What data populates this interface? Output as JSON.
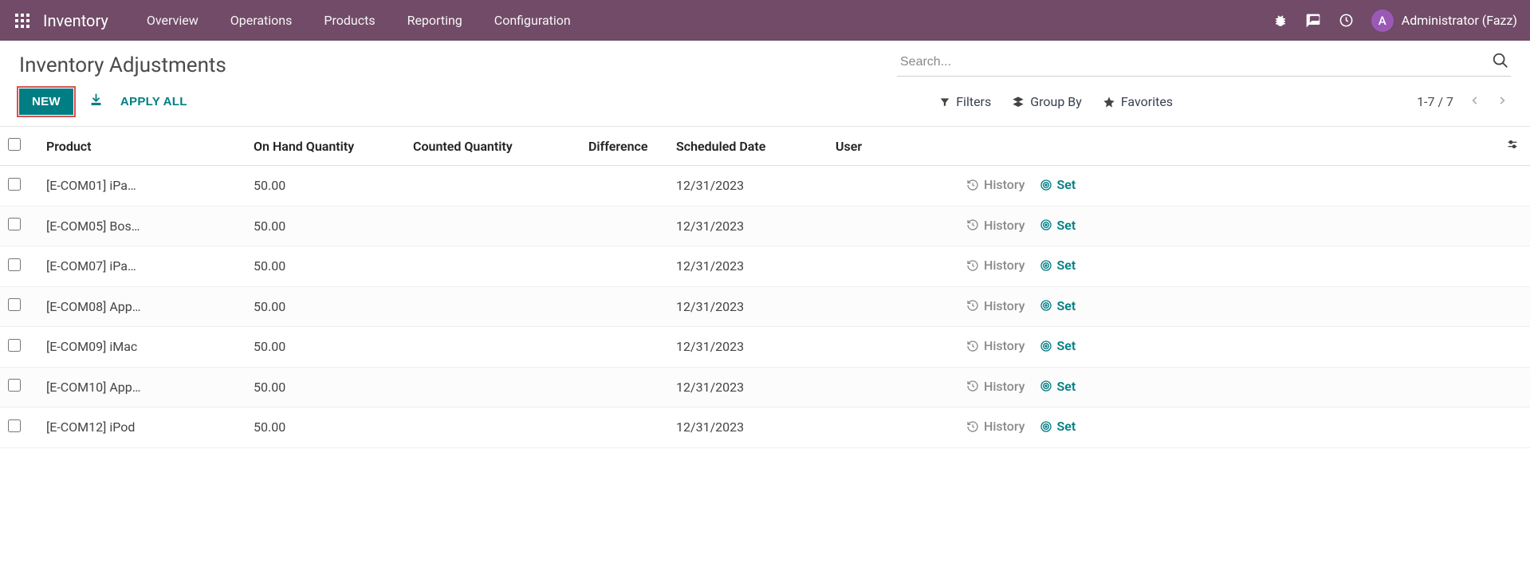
{
  "navbar": {
    "app_name": "Inventory",
    "links": [
      "Overview",
      "Operations",
      "Products",
      "Reporting",
      "Configuration"
    ],
    "user_initial": "A",
    "user_name": "Administrator (Fazz)"
  },
  "page": {
    "title": "Inventory Adjustments",
    "new_label": "NEW",
    "apply_all_label": "APPLY ALL",
    "search_placeholder": "Search...",
    "filters_label": "Filters",
    "groupby_label": "Group By",
    "favorites_label": "Favorites",
    "pager": "1-7 / 7"
  },
  "table": {
    "headers": {
      "product": "Product",
      "onhand": "On Hand Quantity",
      "counted": "Counted Quantity",
      "difference": "Difference",
      "scheduled": "Scheduled Date",
      "user": "User"
    },
    "row_actions": {
      "history": "History",
      "set": "Set"
    },
    "rows": [
      {
        "product": "[E-COM01] iPa…",
        "onhand": "50.00",
        "counted": "",
        "difference": "",
        "date": "12/31/2023",
        "user": ""
      },
      {
        "product": "[E-COM05] Bos…",
        "onhand": "50.00",
        "counted": "",
        "difference": "",
        "date": "12/31/2023",
        "user": ""
      },
      {
        "product": "[E-COM07] iPa…",
        "onhand": "50.00",
        "counted": "",
        "difference": "",
        "date": "12/31/2023",
        "user": ""
      },
      {
        "product": "[E-COM08] App…",
        "onhand": "50.00",
        "counted": "",
        "difference": "",
        "date": "12/31/2023",
        "user": ""
      },
      {
        "product": "[E-COM09] iMac",
        "onhand": "50.00",
        "counted": "",
        "difference": "",
        "date": "12/31/2023",
        "user": ""
      },
      {
        "product": "[E-COM10] App…",
        "onhand": "50.00",
        "counted": "",
        "difference": "",
        "date": "12/31/2023",
        "user": ""
      },
      {
        "product": "[E-COM12] iPod",
        "onhand": "50.00",
        "counted": "",
        "difference": "",
        "date": "12/31/2023",
        "user": ""
      }
    ]
  }
}
